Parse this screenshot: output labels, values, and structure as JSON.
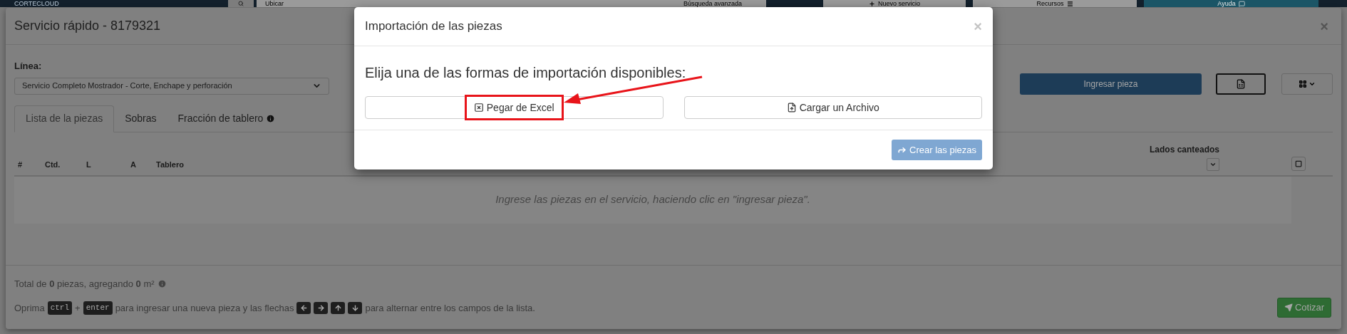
{
  "navbar": {
    "logo": "CORTECLOUD",
    "search_placeholder": "Ubicar",
    "items": [
      {
        "kind": "advanced",
        "label": "Búsqueda avanzada"
      },
      {
        "kind": "new",
        "label": "Nuevo servicio"
      },
      {
        "kind": "resources",
        "label": "Recursos"
      },
      {
        "kind": "help",
        "label": "Ayuda"
      }
    ]
  },
  "service_dialog": {
    "title": "Servicio rápido - 8179321",
    "close": "×",
    "line_label": "Línea:",
    "line_value": "Servicio Completo Mostrador - Corte, Enchape y perforación",
    "add_button": "Ingresar pieza",
    "tabs": [
      {
        "label": "Lista de la piezas",
        "selected": true,
        "info": false
      },
      {
        "label": "Sobras",
        "selected": false,
        "info": false
      },
      {
        "label": "Fracción de tablero",
        "selected": false,
        "info": true
      }
    ],
    "table": {
      "columns": [
        "#",
        "Ctd.",
        "L",
        "A",
        "Tablero"
      ],
      "edge_column": "Lados canteados",
      "empty_message": "Ingrese las piezas en el servicio, haciendo clic en \"ingresar pieza\"."
    },
    "summary": "Total de **0** piezas, agregando **0** m²",
    "hint": [
      {
        "kind": "text",
        "text": "Oprima"
      },
      {
        "kind": "key",
        "text": "ctrl"
      },
      {
        "kind": "text",
        "text": "+"
      },
      {
        "kind": "key",
        "text": "enter"
      },
      {
        "kind": "text",
        "text": "para ingresar una nueva pieza y las flechas"
      },
      {
        "kind": "arrow-left"
      },
      {
        "kind": "arrow-right"
      },
      {
        "kind": "arrow-up"
      },
      {
        "kind": "arrow-down"
      },
      {
        "kind": "text",
        "text": "para alternar entre los campos de la lista."
      }
    ],
    "quote_button": "Cotizar"
  },
  "import_dialog": {
    "title": "Importación de las piezas",
    "close": "×",
    "prompt": "Elija una de las formas de importación disponibles:",
    "options": [
      {
        "kind": "paste",
        "label": "Pegar de Excel",
        "highlighted": true
      },
      {
        "kind": "file",
        "label": "Cargar un Archivo",
        "highlighted": false
      }
    ],
    "create_button": {
      "label": "Crear las piezas",
      "disabled": true
    }
  }
}
